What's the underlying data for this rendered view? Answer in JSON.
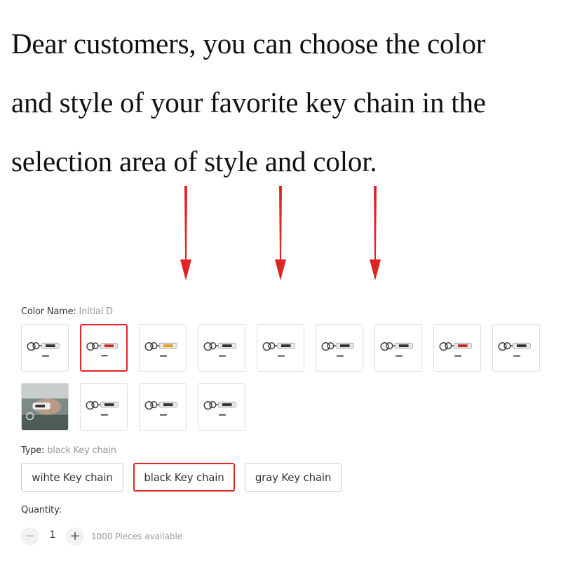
{
  "headline": {
    "line1": "Dear customers, you can choose the color",
    "line2": "and style of your favorite key chain in the",
    "line3": "selection area of style and color."
  },
  "arrow_color": "#e02424",
  "color_name": {
    "label": "Color Name:",
    "value": "Initial D",
    "selected_index": 1,
    "options_icon": "keychain-thumbnail-icon",
    "options_count": 13
  },
  "type": {
    "label": "Type:",
    "value": "black Key chain",
    "options": [
      "wihte Key chain",
      "black Key chain",
      "gray Key chain"
    ],
    "selected_index": 1
  },
  "quantity": {
    "label": "Quantity:",
    "minus": "−",
    "value": "1",
    "plus": "+",
    "available": "1000 Pieces available"
  },
  "colors": {
    "accent": "#e02424",
    "border": "#dddddd",
    "muted": "#999999"
  }
}
